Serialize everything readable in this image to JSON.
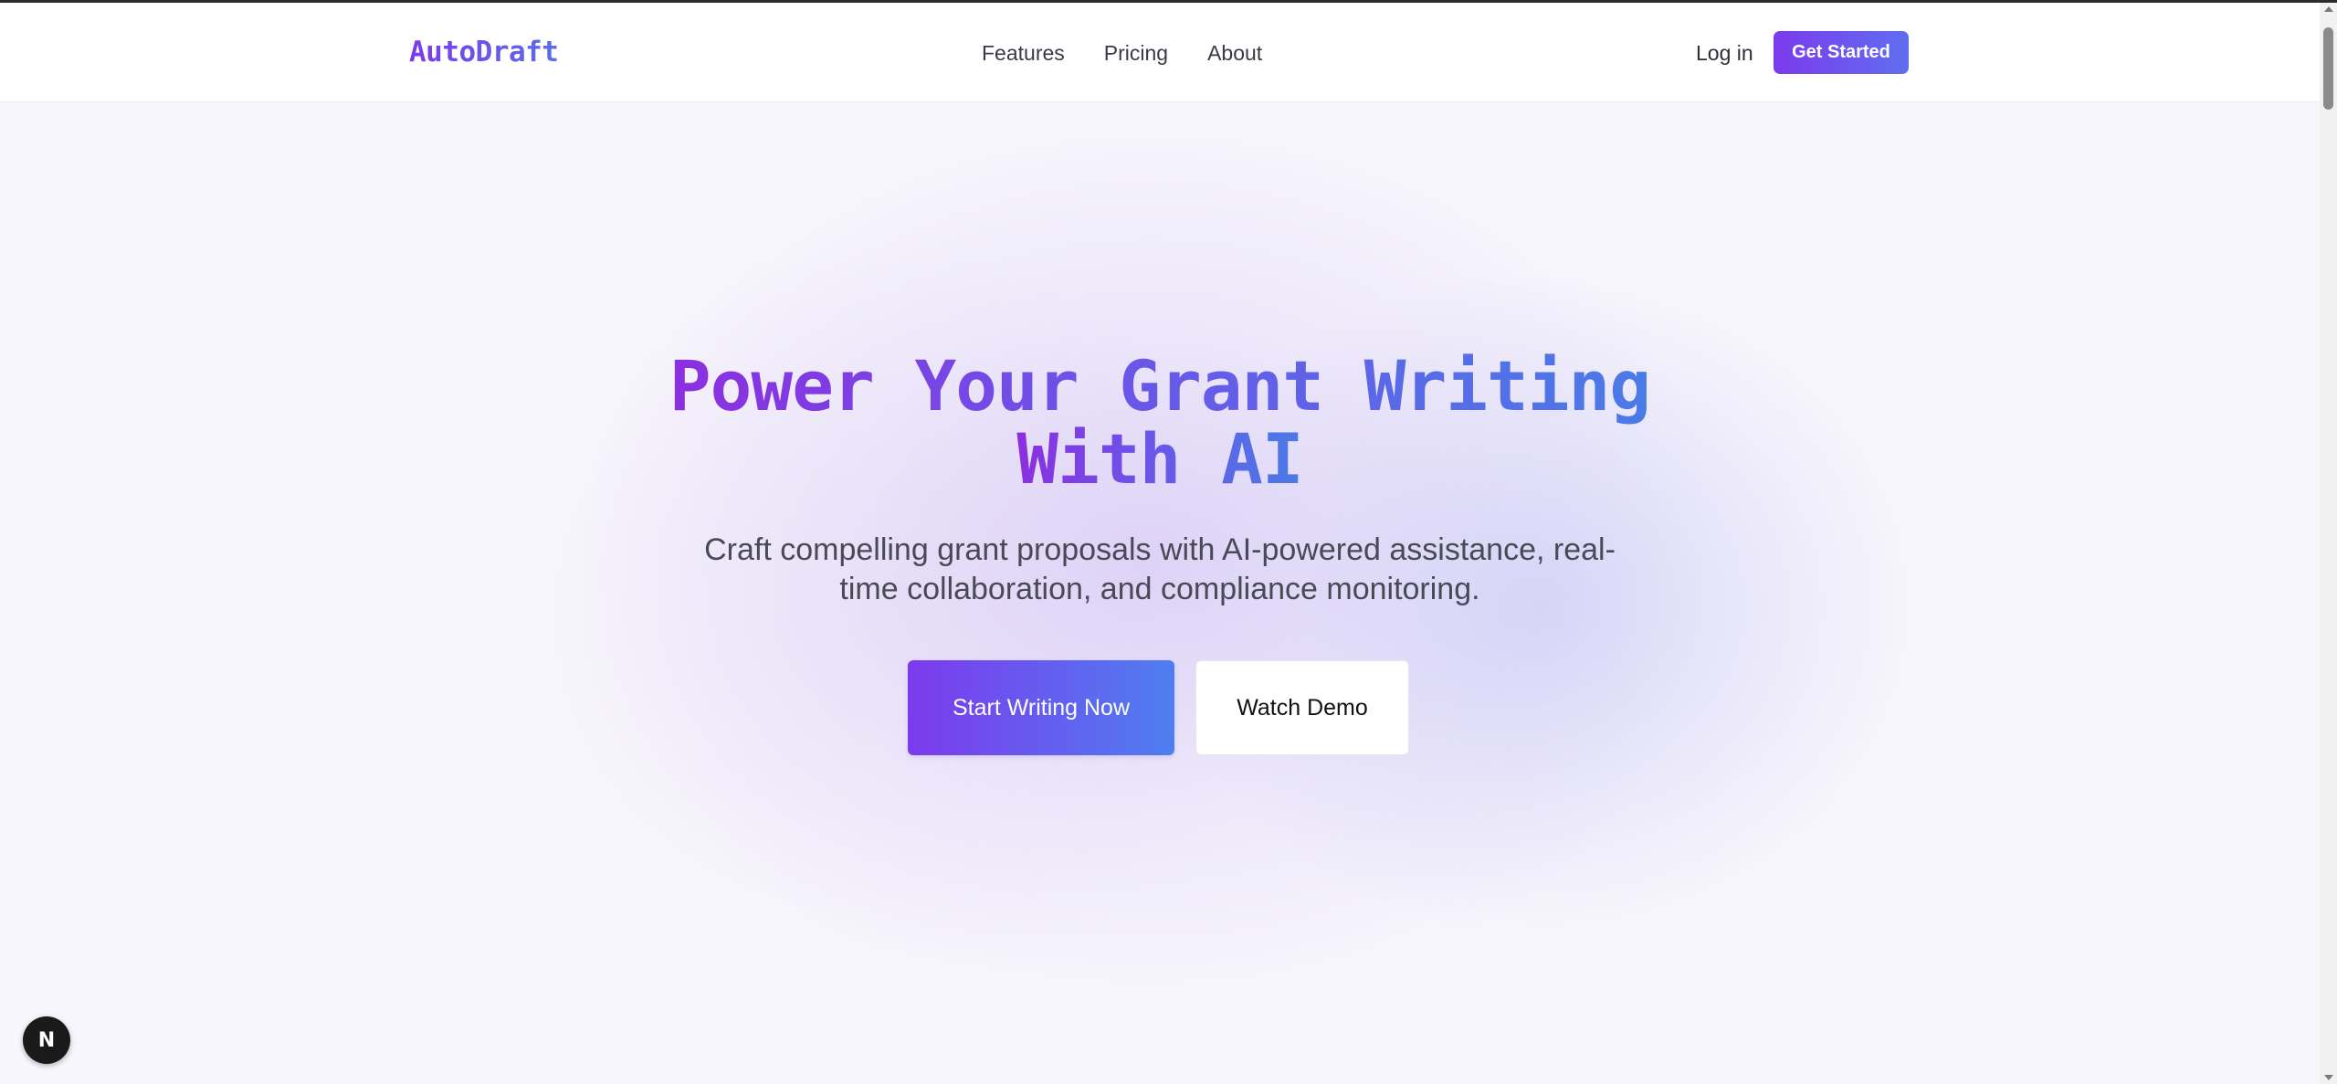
{
  "brand": {
    "logo_text": "AutoDraft",
    "accent_start": "#7c3aed",
    "accent_end": "#4f7ef0"
  },
  "nav": {
    "links": [
      "Features",
      "Pricing",
      "About"
    ],
    "login_label": "Log in",
    "cta_label": "Get Started"
  },
  "hero": {
    "title_line1": "Power Your Grant Writing",
    "title_line2": "With AI",
    "subtitle_line1": "Craft compelling grant proposals with AI-powered assistance, real-",
    "subtitle_line2": "time collaboration, and compliance monitoring.",
    "primary_button": "Start Writing Now",
    "secondary_button": "Watch Demo"
  },
  "dev_badge": {
    "glyph": "N",
    "icon": "nextjs-dev-indicator-icon"
  }
}
